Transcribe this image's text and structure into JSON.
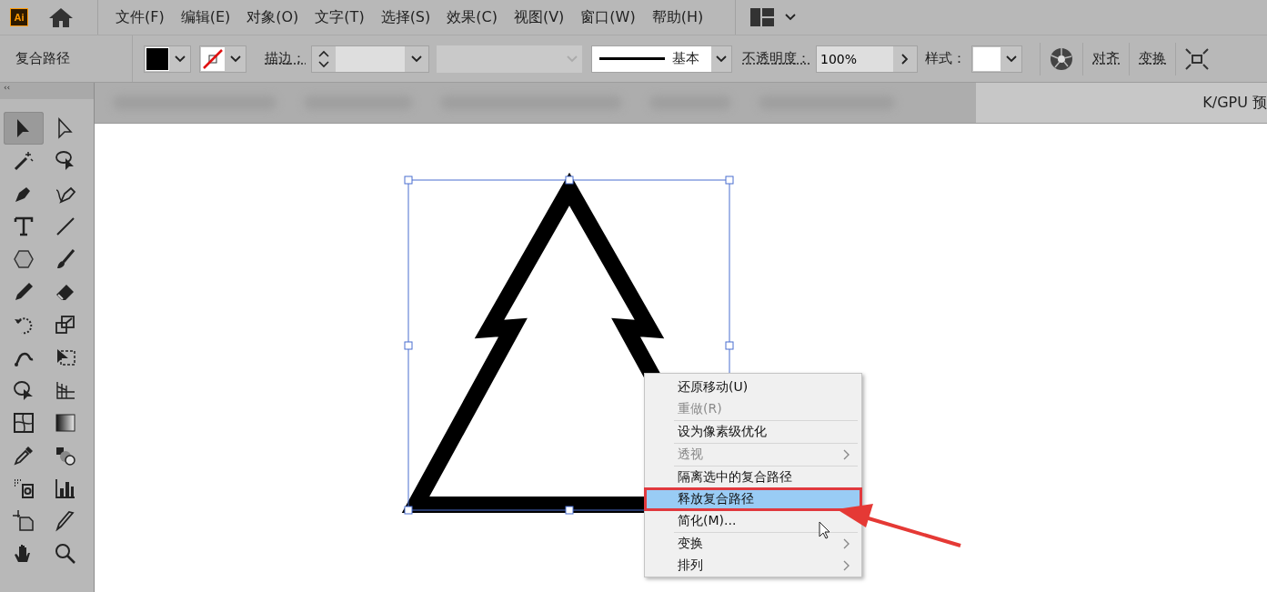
{
  "app_logo": {
    "text": "Ai"
  },
  "menubar": {
    "items": [
      "文件(F)",
      "编辑(E)",
      "对象(O)",
      "文字(T)",
      "选择(S)",
      "效果(C)",
      "视图(V)",
      "窗口(W)",
      "帮助(H)"
    ]
  },
  "control_bar": {
    "selection_label": "复合路径",
    "stroke_label": "描边：",
    "stroke_style": "基本",
    "opacity_label": "不透明度：",
    "opacity_value": "100%",
    "style_label": "样式：",
    "align_link": "对齐",
    "transform_link": "变换"
  },
  "document_tab": {
    "text": "K/GPU 预"
  },
  "tool_panel": {
    "collapse": "‹‹"
  },
  "tools": [
    {
      "kind": "selection",
      "selected": true
    },
    {
      "kind": "direct-selection",
      "selected": false
    },
    {
      "kind": "magic-wand",
      "selected": false
    },
    {
      "kind": "lasso",
      "selected": false
    },
    {
      "kind": "pen",
      "selected": false
    },
    {
      "kind": "curvature",
      "selected": false
    },
    {
      "kind": "type",
      "selected": false
    },
    {
      "kind": "line",
      "selected": false
    },
    {
      "kind": "polygon",
      "selected": false
    },
    {
      "kind": "brush",
      "selected": false
    },
    {
      "kind": "pencil",
      "selected": false
    },
    {
      "kind": "eraser",
      "selected": false
    },
    {
      "kind": "rotate",
      "selected": false
    },
    {
      "kind": "scale",
      "selected": false
    },
    {
      "kind": "warp",
      "selected": false
    },
    {
      "kind": "free-transform",
      "selected": false
    },
    {
      "kind": "puppet",
      "selected": false
    },
    {
      "kind": "perspective",
      "selected": false
    },
    {
      "kind": "mesh",
      "selected": false
    },
    {
      "kind": "gradient",
      "selected": false
    },
    {
      "kind": "eyedropper",
      "selected": false
    },
    {
      "kind": "blend",
      "selected": false
    },
    {
      "kind": "symbol",
      "selected": false
    },
    {
      "kind": "graph",
      "selected": false
    },
    {
      "kind": "artboard",
      "selected": false
    },
    {
      "kind": "slice",
      "selected": false
    },
    {
      "kind": "hand",
      "selected": false
    },
    {
      "kind": "zoom",
      "selected": false
    }
  ],
  "context_menu": {
    "groups": [
      [
        {
          "label": "还原移动(U)",
          "disabled": false,
          "submenu": false,
          "selected": false
        },
        {
          "label": "重做(R)",
          "disabled": true,
          "submenu": false,
          "selected": false
        }
      ],
      [
        {
          "label": "设为像素级优化",
          "disabled": false,
          "submenu": false,
          "selected": false
        }
      ],
      [
        {
          "label": "透视",
          "disabled": true,
          "submenu": true,
          "selected": false
        }
      ],
      [
        {
          "label": "隔离选中的复合路径",
          "disabled": false,
          "submenu": false,
          "selected": false
        },
        {
          "label": "释放复合路径",
          "disabled": false,
          "submenu": false,
          "selected": true
        },
        {
          "label": "简化(M)...",
          "disabled": false,
          "submenu": false,
          "selected": false
        }
      ],
      [
        {
          "label": "变换",
          "disabled": false,
          "submenu": true,
          "selected": false
        },
        {
          "label": "排列",
          "disabled": false,
          "submenu": true,
          "selected": false
        }
      ]
    ]
  }
}
